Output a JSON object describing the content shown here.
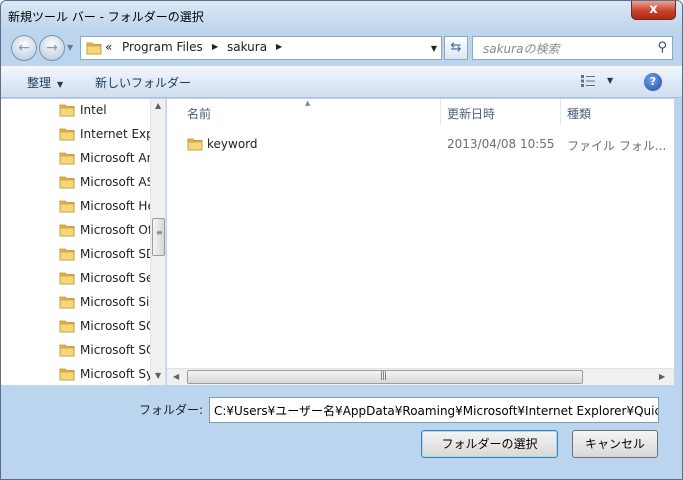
{
  "window": {
    "title": "新規ツール バー - フォルダーの選択",
    "close_label": "x"
  },
  "nav": {
    "back_label": "←",
    "forward_label": "→",
    "address_chevron": "«",
    "breadcrumbs": [
      "Program Files",
      "sakura"
    ],
    "search_placeholder": "sakuraの検索"
  },
  "toolbar": {
    "organize_label": "整理",
    "new_folder_label": "新しいフォルダー",
    "help_label": "?"
  },
  "tree": {
    "items": [
      "Intel",
      "Internet Exp",
      "Microsoft An",
      "Microsoft AS",
      "Microsoft He",
      "Microsoft Of",
      "Microsoft SD",
      "Microsoft Se",
      "Microsoft Si",
      "Microsoft SQ",
      "Microsoft SQ",
      "Microsoft Sy"
    ]
  },
  "file_list": {
    "columns": [
      "名前",
      "更新日時",
      "種類"
    ],
    "rows": [
      {
        "name": "keyword",
        "date": "2013/04/08 10:55",
        "type": "ファイル フォル..."
      }
    ]
  },
  "footer": {
    "folder_label": "フォルダー:",
    "folder_path": "C:¥Users¥ユーザー名¥AppData¥Roaming¥Microsoft¥Internet Explorer¥Quick",
    "select_button": "フォルダーの選択",
    "cancel_button": "キャンセル"
  },
  "colors": {
    "accent": "#bcd5ee",
    "folder": "#e8c45a",
    "close": "#c7412b"
  }
}
